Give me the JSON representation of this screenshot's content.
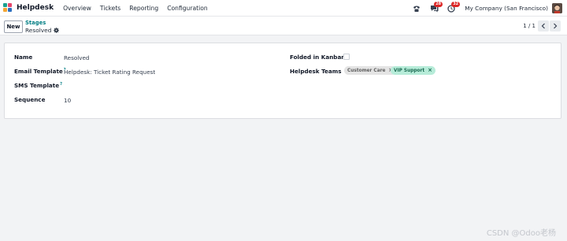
{
  "navbar": {
    "app_name": "Helpdesk",
    "menu": [
      "Overview",
      "Tickets",
      "Reporting",
      "Configuration"
    ],
    "messages_count": "28",
    "activities_count": "32",
    "company": "My Company (San Francisco)"
  },
  "control": {
    "new_label": "New",
    "breadcrumb_parent": "Stages",
    "breadcrumb_current": "Resolved",
    "pager": "1 / 1"
  },
  "form": {
    "name_label": "Name",
    "name_value": "Resolved",
    "email_template_label": "Email Template",
    "email_template_value": "Helpdesk: Ticket Rating Request",
    "sms_template_label": "SMS Template",
    "sequence_label": "Sequence",
    "sequence_value": "10",
    "folded_label": "Folded in Kanban",
    "folded_value": false,
    "teams_label": "Helpdesk Teams",
    "help_marker": "?",
    "teams": [
      "Customer Care",
      "VIP Support"
    ],
    "tag_colors": {
      "Customer Care": "#e4e4e4",
      "VIP Support": "#b7ecd9"
    }
  },
  "watermark": "CSDN @Odoo老杨"
}
